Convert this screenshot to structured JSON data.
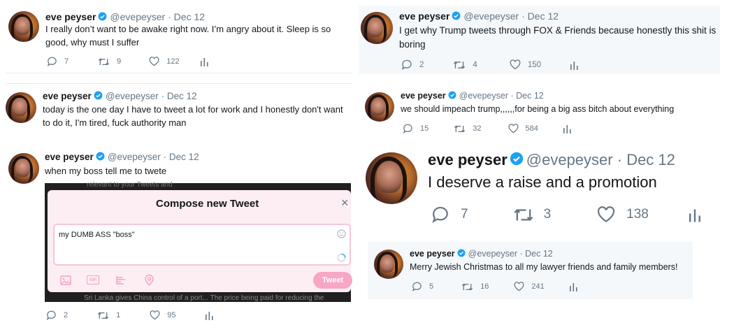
{
  "colors": {
    "verified": "#1da1f2",
    "icon_gray": "#657786",
    "compose_pink": "#fdeef3",
    "tweet_button": "#f7a7c3"
  },
  "tweets": [
    {
      "name": "eve peyser",
      "handle": "@evepeyser",
      "dot": "·",
      "date": "Dec 12",
      "text": "I really don’t want to be awake right now. I’m angry about it. Sleep is so good, why must I suffer",
      "replies": "7",
      "retweets": "9",
      "likes": "122"
    },
    {
      "name": "eve peyser",
      "handle": "@evepeyser",
      "dot": "·",
      "date": "Dec 12",
      "text": "today is the one day I have to tweet a lot for work and I honestly don't want to do it, I'm tired, fuck authority man"
    },
    {
      "name": "eve peyser",
      "handle": "@evepeyser",
      "dot": "·",
      "date": "Dec 12",
      "text": "when my boss tell me to twete",
      "replies": "2",
      "retweets": "1",
      "likes": "95",
      "compose": {
        "title": "Compose new Tweet",
        "close": "×",
        "input_value": "my DUMB ASS \"boss\"",
        "button": "Tweet",
        "tools": [
          "image-icon",
          "gif-icon",
          "poll-icon",
          "location-icon"
        ],
        "gif_label": "GIF",
        "bg_text_top": "relevant to your Tweets and",
        "bg_text_bottom": "Sri Lanka gives China control of a port... The price being paid for reducing the"
      }
    },
    {
      "name": "eve peyser",
      "handle": "@evepeyser",
      "dot": "·",
      "date": "Dec 12",
      "text": "I get why Trump tweets through FOX & Friends because honestly this shit is boring",
      "replies": "2",
      "retweets": "4",
      "likes": "150"
    },
    {
      "name": "eve peyser",
      "handle": "@evepeyser",
      "dot": "·",
      "date": "Dec 12",
      "text": "we should impeach trump,,,,,,for being a big ass bitch about everything",
      "replies": "15",
      "retweets": "32",
      "likes": "584"
    },
    {
      "name": "eve peyser",
      "handle": "@evepeyser",
      "dot": "·",
      "date": "Dec 12",
      "text": "I deserve a raise and a promotion",
      "replies": "7",
      "retweets": "3",
      "likes": "138"
    },
    {
      "name": "eve peyser",
      "handle": "@evepeyser",
      "dot": "·",
      "date": "Dec 12",
      "text": "Merry Jewish Christmas to all my lawyer friends and family members!",
      "replies": "5",
      "retweets": "16",
      "likes": "241"
    }
  ]
}
